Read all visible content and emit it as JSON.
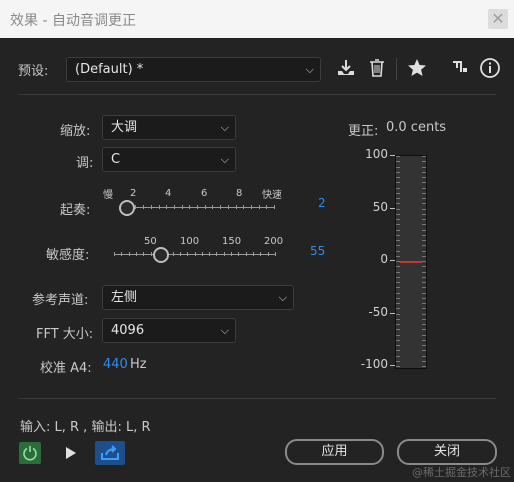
{
  "window": {
    "title": "效果 - 自动音调更正",
    "close_glyph": "✕"
  },
  "preset": {
    "label": "预设:",
    "value": "(Default) *"
  },
  "scale": {
    "label": "缩放:",
    "value": "大调"
  },
  "key": {
    "label": "调:",
    "value": "C"
  },
  "attack": {
    "label": "起奏:",
    "tick_labels": [
      "慢",
      "2",
      "4",
      "6",
      "8",
      "快速"
    ],
    "value": "2",
    "level": 0.0
  },
  "sensitivity": {
    "label": "敏感度:",
    "tick_labels": [
      "50",
      "100",
      "150",
      "200"
    ],
    "value": "55",
    "level_value": 55
  },
  "reference_channel": {
    "label": "参考声道:",
    "value": "左侧"
  },
  "fft_size": {
    "label": "FFT 大小:",
    "value": "4096"
  },
  "calibration": {
    "label": "校准 A4:",
    "value": "440",
    "unit": "Hz"
  },
  "correction": {
    "label": "更正:",
    "value": "0.0 cents",
    "scale_labels": [
      "100",
      "50",
      "0",
      "-50",
      "-100"
    ],
    "current_cents": 0
  },
  "io": {
    "text": "输入: L, R , 输出: L, R"
  },
  "buttons": {
    "apply": "应用",
    "close": "关闭"
  },
  "watermark": "@稀土掘金技术社区",
  "colors": {
    "accent": "#2e8cf0",
    "power": "#2d6b3a",
    "meter_marker": "#c0392b"
  }
}
